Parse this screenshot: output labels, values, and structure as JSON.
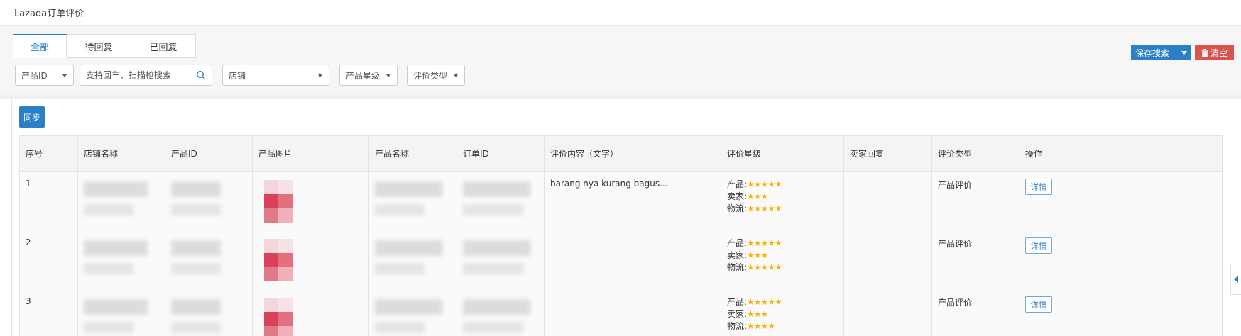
{
  "page": {
    "title": "Lazada订单评价"
  },
  "tabs": [
    {
      "label": "全部",
      "active": true
    },
    {
      "label": "待回复",
      "active": false
    },
    {
      "label": "已回复",
      "active": false
    }
  ],
  "filters": {
    "product_id_select": "产品ID",
    "search_placeholder": "支持回车、扫描枪搜索",
    "shop_select": "店铺",
    "product_rating_select": "产品星级",
    "review_type_select": "评价类型"
  },
  "actions": {
    "save_search": "保存搜索",
    "clear": "清空",
    "sync": "同步"
  },
  "colors": {
    "primary": "#2b7fc7",
    "danger": "#d9534f",
    "star": "#f5b30c"
  },
  "table": {
    "columns": [
      "序号",
      "店铺名称",
      "产品ID",
      "产品图片",
      "产品名称",
      "订单ID",
      "评价内容（文字）",
      "评价星级",
      "卖家回复",
      "评价类型",
      "操作"
    ],
    "rating_labels": {
      "product": "产品:",
      "seller": "卖家:",
      "logistics": "物流:"
    },
    "detail_label": "详情",
    "rows": [
      {
        "index": "1",
        "review_text": "barang nya kurang bagus...",
        "product_stars": "★★★★★",
        "seller_stars": "★★★",
        "logistics_stars": "★★★★★",
        "seller_reply": "",
        "review_type": "产品评价"
      },
      {
        "index": "2",
        "review_text": "",
        "product_stars": "★★★★★",
        "seller_stars": "★★★",
        "logistics_stars": "★★★★★",
        "seller_reply": "",
        "review_type": "产品评价"
      },
      {
        "index": "3",
        "review_text": "",
        "product_stars": "★★★★★",
        "seller_stars": "★★★",
        "logistics_stars": "★★★★",
        "seller_reply": "",
        "review_type": "产品评价"
      }
    ]
  }
}
